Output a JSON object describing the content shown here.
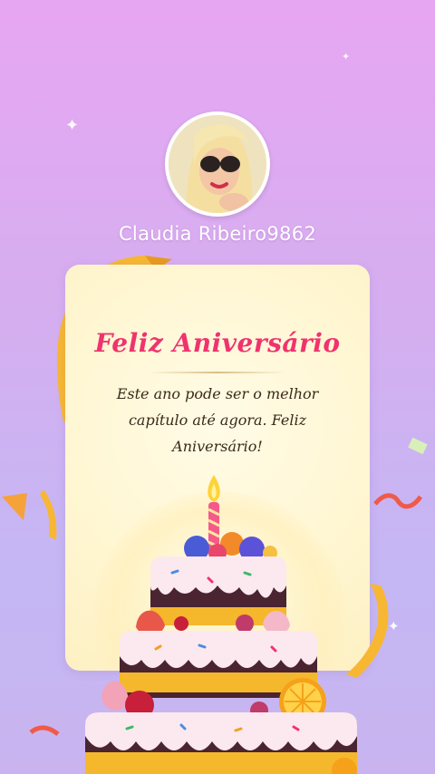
{
  "profile": {
    "username": "Claudia Ribeiro9862"
  },
  "card": {
    "title": "Feliz Aniversário",
    "message": "Este ano pode ser o melhor capítulo até agora. Feliz Aniversário!"
  },
  "colors": {
    "title": "#f0336e",
    "background_top": "#e7a6f2",
    "background_bottom": "#c4b7f4",
    "ribbon": "#f7b733"
  },
  "icons": [
    "sparkle-icon",
    "birthday-cake-illustration",
    "candle-icon"
  ]
}
